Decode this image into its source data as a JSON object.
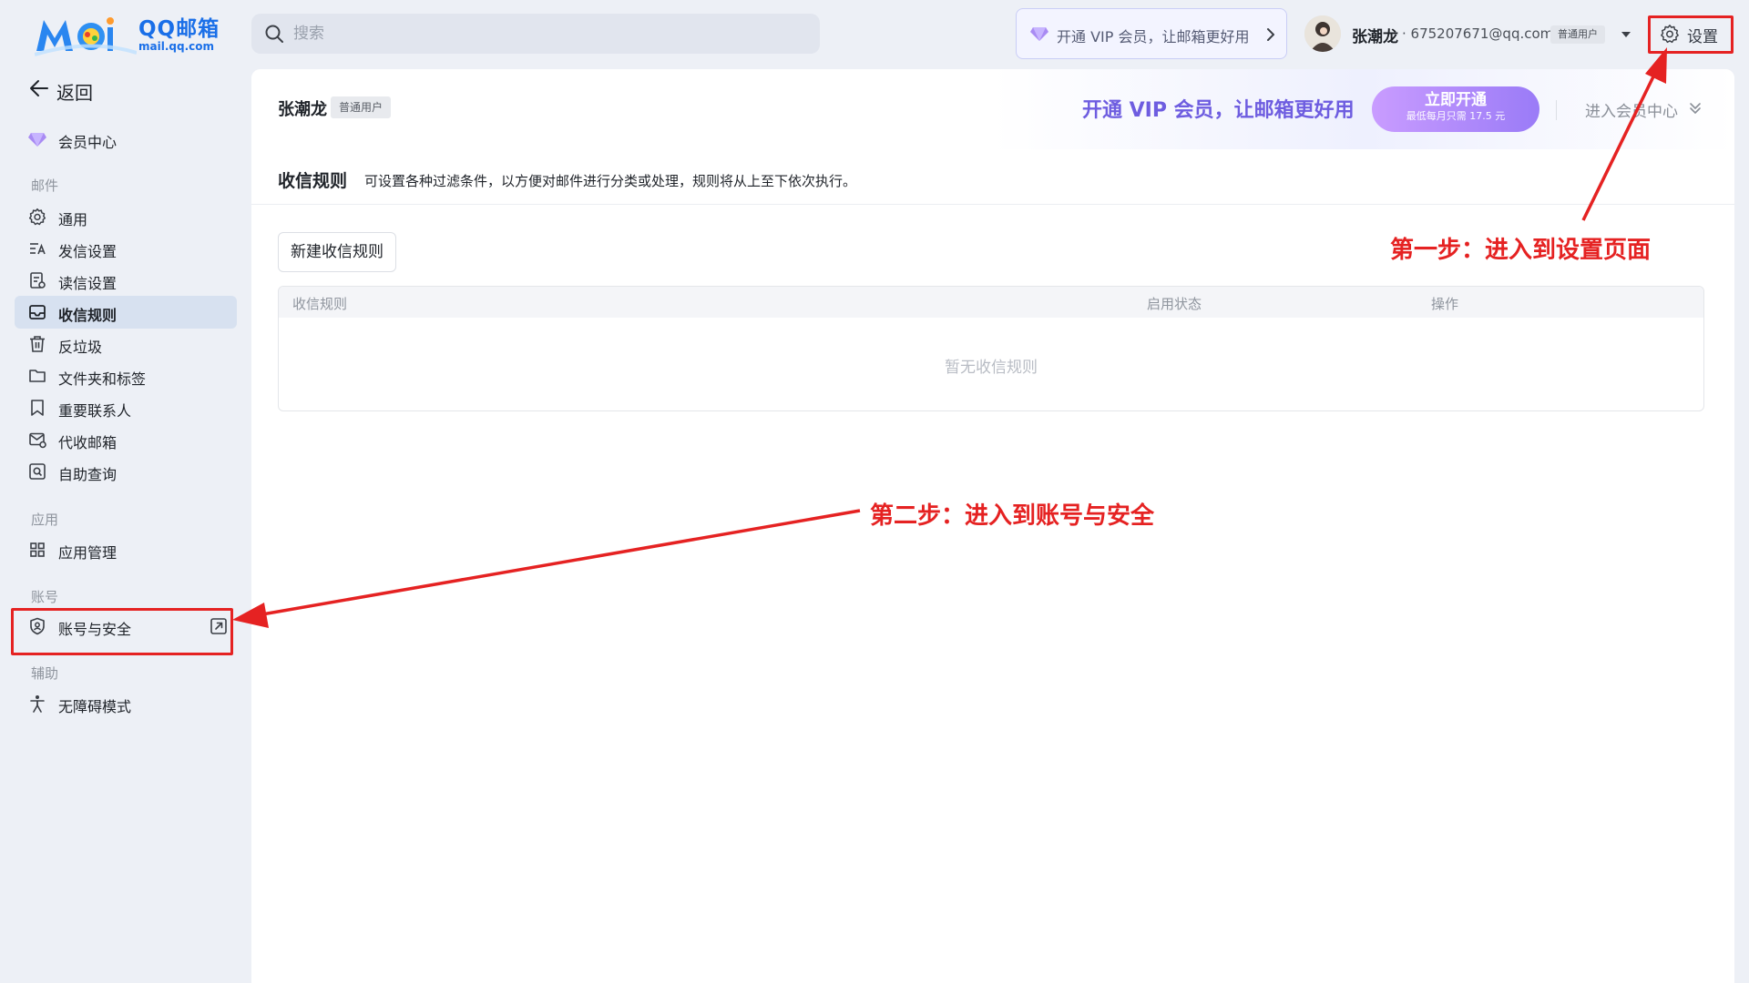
{
  "logo": {
    "name": "QQ邮箱",
    "url": "mail.qq.com"
  },
  "search": {
    "placeholder": "搜索"
  },
  "vip_banner": {
    "text": "开通 VIP 会员，让邮箱更好用"
  },
  "user": {
    "name": "张潮龙",
    "email": "· 675207671@qq.com",
    "badge": "普通用户"
  },
  "settings": {
    "label": "设置"
  },
  "sidebar": {
    "back_label": "返回",
    "member_center": "会员中心",
    "sections": {
      "mail": "邮件",
      "apps": "应用",
      "account": "账号",
      "assist": "辅助"
    },
    "mail_items": [
      "通用",
      "发信设置",
      "读信设置",
      "收信规则",
      "反垃圾",
      "文件夹和标签",
      "重要联系人",
      "代收邮箱",
      "自助查询"
    ],
    "app_items": [
      "应用管理"
    ],
    "account_items": [
      "账号与安全"
    ],
    "assist_items": [
      "无障碍模式"
    ],
    "active_item": "收信规则"
  },
  "panel_header": {
    "name": "张潮龙",
    "badge": "普通用户",
    "vip_slogan": "开通 VIP 会员，让邮箱更好用",
    "button_main": "立即开通",
    "button_sub": "最低每月只需 17.5 元",
    "enter_center": "进入会员中心"
  },
  "rules": {
    "title": "收信规则",
    "description": "可设置各种过滤条件，以方便对邮件进行分类或处理，规则将从上至下依次执行。",
    "new_button": "新建收信规则",
    "columns": [
      "收信规则",
      "启用状态",
      "操作"
    ],
    "empty_text": "暂无收信规则"
  },
  "annotations": {
    "step1": "第一步：进入到设置页面",
    "step2": "第二步：进入到账号与安全"
  },
  "colors": {
    "accent": "#6e5de0",
    "annotation": "#e52222",
    "active_nav": "#d7e1f0"
  }
}
